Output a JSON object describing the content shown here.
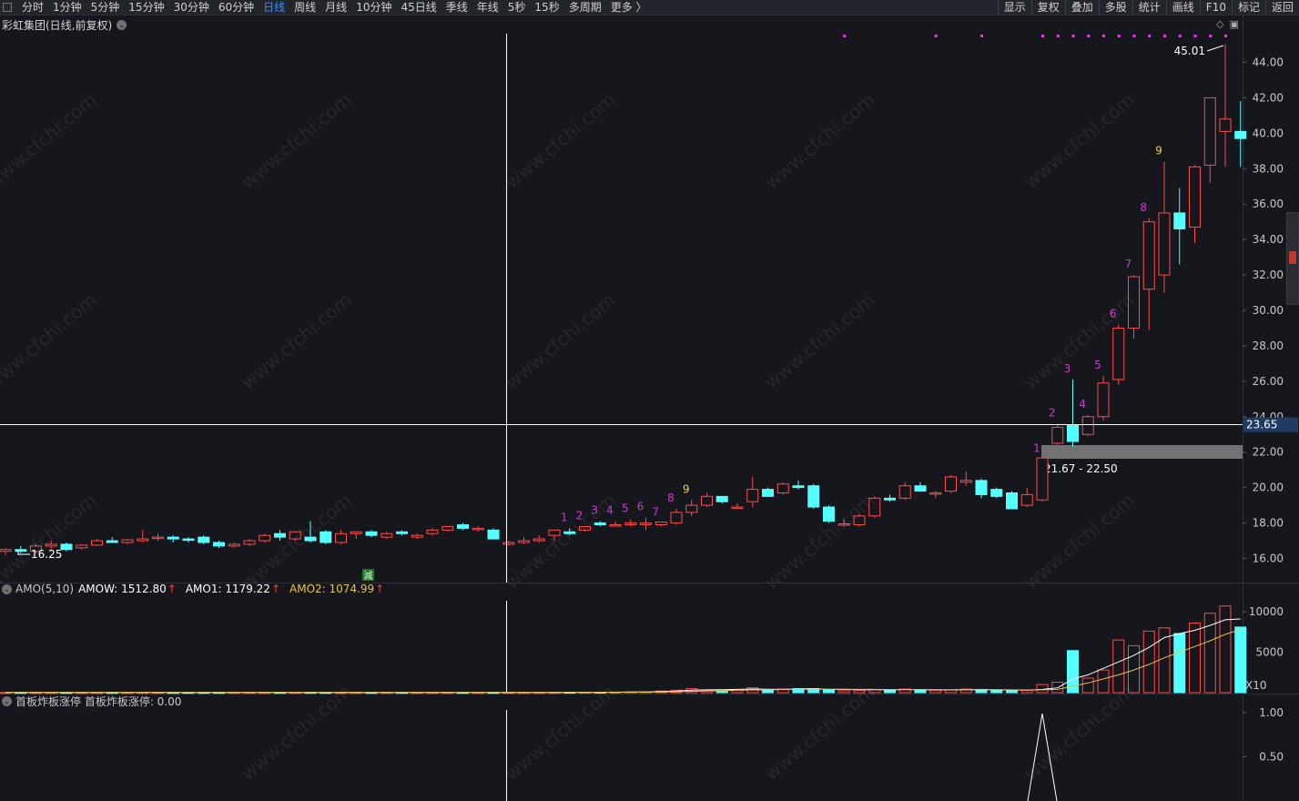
{
  "toolbar": {
    "periods": [
      "分时",
      "1分钟",
      "5分钟",
      "15分钟",
      "30分钟",
      "60分钟",
      "日线",
      "周线",
      "月线",
      "10分钟",
      "45日线",
      "季线",
      "年线",
      "5秒",
      "15秒",
      "多周期",
      "更多 〉"
    ],
    "active_period": "日线",
    "right_tools": [
      "显示",
      "复权",
      "叠加",
      "多股",
      "统计",
      "画线",
      "F10",
      "标记",
      "返回"
    ]
  },
  "stock": {
    "title": "彩虹集团(日线,前复权)"
  },
  "price_labels": {
    "y_axis": [
      "44.00",
      "42.00",
      "40.00",
      "38.00",
      "36.00",
      "34.00",
      "32.00",
      "30.00",
      "28.00",
      "26.00",
      "24.00",
      "22.00",
      "20.00",
      "18.00",
      "16.00"
    ],
    "crosshair_price": "23.65",
    "high_marker": "45.01",
    "low_marker": "16.25",
    "zone_label": "21.67 - 22.50",
    "jian_badge": "減"
  },
  "amo_header": {
    "name": "AMO(5,10)",
    "amow": "AMOW: 1512.80",
    "amo1": "AMO1: 1179.22",
    "amo2": "AMO2: 1074.99",
    "arrow": "↑"
  },
  "amo_axis": [
    "10000",
    "5000"
  ],
  "amo_multiplier": "X10",
  "limit_header": {
    "text": "首板炸板涨停  首板炸板涨停: 0.00"
  },
  "limit_axis": [
    "1.00",
    "0.50"
  ],
  "colors": {
    "up": "#ff4b4b",
    "down": "#54ffff",
    "bg": "#16171d",
    "amo1_line": "#ffffff",
    "amo2_line": "#e8c04a",
    "seq_magenta": "#d633d6",
    "seq_yellow": "#f0d040"
  },
  "chart_data": {
    "type": "candlestick",
    "ylim": [
      15.0,
      46.0
    ],
    "candles": [
      [
        16.4,
        16.6,
        16.2,
        16.5
      ],
      [
        16.5,
        16.7,
        16.3,
        16.4
      ],
      [
        16.4,
        16.8,
        16.3,
        16.7
      ],
      [
        16.7,
        17.0,
        16.5,
        16.8
      ],
      [
        16.8,
        16.9,
        16.4,
        16.5
      ],
      [
        16.6,
        16.8,
        16.5,
        16.75
      ],
      [
        16.75,
        17.1,
        16.7,
        17.0
      ],
      [
        17.0,
        17.2,
        16.9,
        16.9
      ],
      [
        16.9,
        17.1,
        16.8,
        17.05
      ],
      [
        17.0,
        17.6,
        16.9,
        17.1
      ],
      [
        17.2,
        17.4,
        17.0,
        17.2
      ],
      [
        17.2,
        17.3,
        16.9,
        17.1
      ],
      [
        17.1,
        17.2,
        16.9,
        17.05
      ],
      [
        17.2,
        17.3,
        16.8,
        16.9
      ],
      [
        16.9,
        17.0,
        16.6,
        16.7
      ],
      [
        16.7,
        16.9,
        16.6,
        16.8
      ],
      [
        16.8,
        17.1,
        16.7,
        17.0
      ],
      [
        17.0,
        17.4,
        16.9,
        17.3
      ],
      [
        17.4,
        17.6,
        17.0,
        17.2
      ],
      [
        17.1,
        17.5,
        17.0,
        17.5
      ],
      [
        17.2,
        18.1,
        16.9,
        17.0
      ],
      [
        17.5,
        17.6,
        16.8,
        16.9
      ],
      [
        16.9,
        17.6,
        16.8,
        17.4
      ],
      [
        17.4,
        17.5,
        17.1,
        17.5
      ],
      [
        17.5,
        17.6,
        17.2,
        17.3
      ],
      [
        17.2,
        17.5,
        17.1,
        17.4
      ],
      [
        17.5,
        17.6,
        17.3,
        17.4
      ],
      [
        17.2,
        17.4,
        17.1,
        17.3
      ],
      [
        17.4,
        17.7,
        17.3,
        17.6
      ],
      [
        17.6,
        17.8,
        17.5,
        17.8
      ],
      [
        17.9,
        18.0,
        17.6,
        17.7
      ],
      [
        17.7,
        17.8,
        17.5,
        17.7
      ],
      [
        17.6,
        17.7,
        17.3,
        17.1
      ],
      [
        16.8,
        17.0,
        16.7,
        16.9
      ],
      [
        16.9,
        17.2,
        16.8,
        17.0
      ],
      [
        17.0,
        17.3,
        16.9,
        17.1
      ],
      [
        17.3,
        17.5,
        17.0,
        17.6
      ],
      [
        17.5,
        17.7,
        17.3,
        17.4
      ],
      [
        17.6,
        17.8,
        17.5,
        17.8
      ],
      [
        18.0,
        18.1,
        17.8,
        17.9
      ],
      [
        17.9,
        18.1,
        17.8,
        17.9
      ],
      [
        17.9,
        18.2,
        17.8,
        18.0
      ],
      [
        17.9,
        18.3,
        17.6,
        18.0
      ],
      [
        17.9,
        18.0,
        17.8,
        18.05
      ],
      [
        18.0,
        18.8,
        17.9,
        18.6
      ],
      [
        18.6,
        19.3,
        18.4,
        19.0
      ],
      [
        19.0,
        19.7,
        18.9,
        19.5
      ],
      [
        19.5,
        19.5,
        19.1,
        19.2
      ],
      [
        18.9,
        19.1,
        18.8,
        18.9
      ],
      [
        19.2,
        20.6,
        18.9,
        19.9
      ],
      [
        19.9,
        20.0,
        19.5,
        19.5
      ],
      [
        19.7,
        20.3,
        19.6,
        20.2
      ],
      [
        20.1,
        20.4,
        19.9,
        20.0
      ],
      [
        20.1,
        20.2,
        18.8,
        18.9
      ],
      [
        18.9,
        19.0,
        18.0,
        18.1
      ],
      [
        17.9,
        18.2,
        17.8,
        17.95
      ],
      [
        17.9,
        18.5,
        17.8,
        18.4
      ],
      [
        18.4,
        19.5,
        18.3,
        19.4
      ],
      [
        19.4,
        19.6,
        19.2,
        19.3
      ],
      [
        19.4,
        20.3,
        19.3,
        20.1
      ],
      [
        20.1,
        20.3,
        19.8,
        19.8
      ],
      [
        19.7,
        19.8,
        19.4,
        19.7
      ],
      [
        19.8,
        20.7,
        19.7,
        20.6
      ],
      [
        20.3,
        20.9,
        20.1,
        20.4
      ],
      [
        20.4,
        20.5,
        19.4,
        19.6
      ],
      [
        19.9,
        20.0,
        19.4,
        19.5
      ],
      [
        19.7,
        19.8,
        18.8,
        18.8
      ],
      [
        19.0,
        20.0,
        18.9,
        19.6
      ],
      [
        19.3,
        21.6,
        19.2,
        21.67
      ],
      [
        22.5,
        23.6,
        22.4,
        23.4
      ],
      [
        23.5,
        26.1,
        22.3,
        22.6
      ],
      [
        23.0,
        24.1,
        22.9,
        24.0
      ],
      [
        24.0,
        26.3,
        23.8,
        25.9
      ],
      [
        26.1,
        29.2,
        25.8,
        29.0
      ],
      [
        29.0,
        32.0,
        28.4,
        31.9
      ],
      [
        31.2,
        35.2,
        28.9,
        35.0
      ],
      [
        32.0,
        38.4,
        31.0,
        35.5
      ],
      [
        35.5,
        36.9,
        32.6,
        34.6
      ],
      [
        34.7,
        38.2,
        33.8,
        38.1
      ],
      [
        38.2,
        42.0,
        37.2,
        42.0
      ],
      [
        40.1,
        45.01,
        38.1,
        40.8
      ],
      [
        40.1,
        41.8,
        38.1,
        39.7
      ]
    ],
    "sequence_labels": [
      {
        "bar": 37,
        "text": "1",
        "side": "above"
      },
      {
        "bar": 38,
        "text": "2",
        "side": "above"
      },
      {
        "bar": 39,
        "text": "3",
        "side": "above"
      },
      {
        "bar": 40,
        "text": "4",
        "side": "above"
      },
      {
        "bar": 41,
        "text": "5",
        "side": "above"
      },
      {
        "bar": 42,
        "text": "6",
        "side": "above"
      },
      {
        "bar": 43,
        "text": "7",
        "side": "above"
      },
      {
        "bar": 44,
        "text": "8",
        "side": "above"
      },
      {
        "bar": 45,
        "text": "9",
        "side": "above"
      },
      {
        "bar": 68,
        "text": "1",
        "side": "above"
      },
      {
        "bar": 69,
        "text": "2",
        "side": "above"
      },
      {
        "bar": 70,
        "text": "3",
        "side": "above"
      },
      {
        "bar": 71,
        "text": "4",
        "side": "above"
      },
      {
        "bar": 72,
        "text": "5",
        "side": "above"
      },
      {
        "bar": 73,
        "text": "6",
        "side": "above"
      },
      {
        "bar": 74,
        "text": "7",
        "side": "above"
      },
      {
        "bar": 75,
        "text": "8",
        "side": "above"
      },
      {
        "bar": 76,
        "text": "9",
        "side": "above"
      }
    ],
    "top_dots_bars": [
      55,
      61,
      64,
      68,
      69,
      70,
      71,
      72,
      73,
      74,
      75,
      76,
      77,
      78,
      79,
      80
    ],
    "amo_volume": [
      30,
      30,
      30,
      30,
      30,
      30,
      30,
      30,
      30,
      30,
      30,
      30,
      30,
      30,
      30,
      30,
      30,
      30,
      30,
      30,
      40,
      30,
      30,
      30,
      30,
      30,
      30,
      30,
      30,
      30,
      30,
      30,
      30,
      30,
      30,
      30,
      40,
      50,
      60,
      60,
      70,
      90,
      100,
      200,
      300,
      500,
      300,
      200,
      300,
      600,
      350,
      450,
      500,
      500,
      350,
      250,
      300,
      380,
      350,
      450,
      380,
      300,
      350,
      450,
      400,
      300,
      250,
      300,
      1000,
      1300,
      5200,
      1800,
      2800,
      6500,
      5800,
      7600,
      8000,
      7300,
      8600,
      9800,
      10700,
      8100
    ],
    "amo1": [
      30,
      30,
      30,
      30,
      30,
      30,
      30,
      30,
      30,
      30,
      30,
      30,
      30,
      30,
      30,
      30,
      30,
      30,
      30,
      30,
      32,
      32,
      32,
      30,
      30,
      30,
      30,
      30,
      30,
      30,
      30,
      30,
      30,
      30,
      30,
      32,
      36,
      40,
      46,
      52,
      60,
      74,
      88,
      130,
      190,
      320,
      350,
      360,
      400,
      450,
      420,
      400,
      450,
      500,
      400,
      400,
      370,
      380,
      350,
      380,
      380,
      350,
      340,
      370,
      380,
      350,
      340,
      300,
      400,
      600,
      1700,
      2200,
      3000,
      3800,
      4600,
      5600,
      6800,
      7300,
      7700,
      8300,
      9000,
      9100
    ],
    "amo2": [
      30,
      30,
      30,
      30,
      30,
      30,
      30,
      30,
      30,
      30,
      30,
      30,
      30,
      30,
      30,
      30,
      30,
      30,
      30,
      30,
      31,
      31,
      31,
      31,
      31,
      31,
      31,
      31,
      31,
      31,
      31,
      31,
      31,
      31,
      31,
      31,
      33,
      35,
      38,
      42,
      46,
      52,
      60,
      80,
      110,
      170,
      210,
      250,
      300,
      340,
      360,
      380,
      400,
      420,
      420,
      420,
      400,
      400,
      380,
      380,
      380,
      370,
      360,
      360,
      360,
      355,
      345,
      335,
      350,
      400,
      800,
      1200,
      1700,
      2200,
      2800,
      3500,
      4300,
      5000,
      5700,
      6400,
      7200,
      7800
    ],
    "limit_signal_bar": 68
  }
}
